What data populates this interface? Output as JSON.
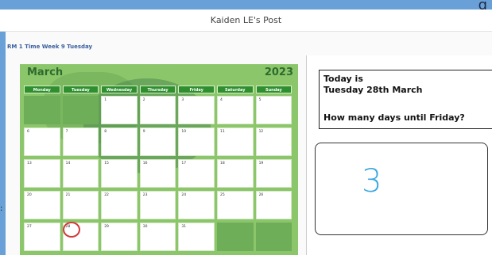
{
  "header": {
    "title": "Kaiden LE's Post",
    "corner_glyph": "g",
    "left_glyph": ":"
  },
  "post": {
    "subtitle": "RM 1 Time Week 9 Tuesday"
  },
  "calendar": {
    "month": "March",
    "year": "2023",
    "day_headers": [
      "Monday",
      "Tuesday",
      "Wednesday",
      "Thursday",
      "Friday",
      "Saturday",
      "Sunday"
    ],
    "weeks": [
      [
        "",
        "",
        "1",
        "2",
        "3",
        "4",
        "5"
      ],
      [
        "6",
        "7",
        "8",
        "9",
        "10",
        "11",
        "12"
      ],
      [
        "13",
        "14",
        "15",
        "16",
        "17",
        "18",
        "19"
      ],
      [
        "20",
        "21",
        "22",
        "23",
        "24",
        "25",
        "26"
      ],
      [
        "27",
        "28",
        "29",
        "30",
        "31",
        "",
        ""
      ]
    ],
    "circled_date": "28",
    "colors": {
      "background": "#8cc66a",
      "header": "#2f8f2f",
      "circle": "#d23a3a"
    }
  },
  "question": {
    "line1": "Today is",
    "line2": "Tuesday 28th March",
    "line3": "How many days until Friday?"
  },
  "answer": {
    "value": "3",
    "color": "#3aa7e0"
  }
}
